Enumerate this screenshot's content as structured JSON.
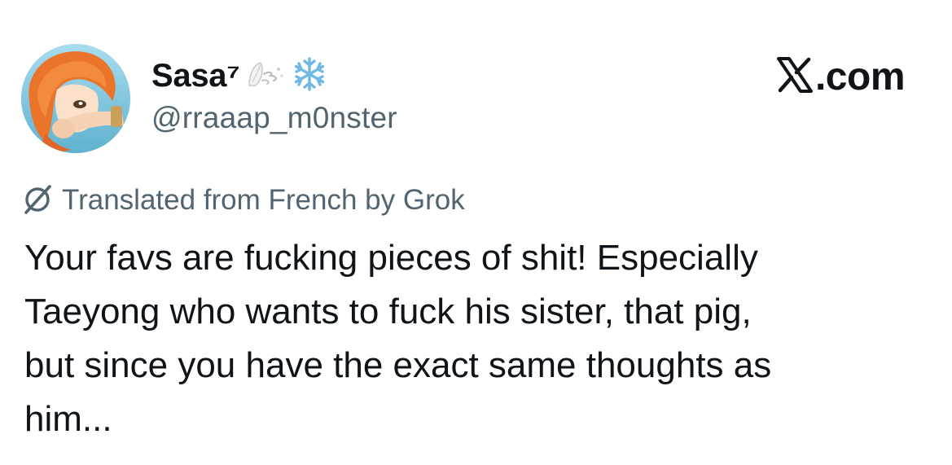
{
  "author": {
    "display_name": "Sasa⁷",
    "handle": "@rraaap_m0nster",
    "name_emojis": [
      "flower-petals-wind-emoji",
      "snowflake-emoji"
    ],
    "avatar": "anime-orange-hair-girl-avatar"
  },
  "brand": {
    "logo": "x-logo-icon",
    "domain": ".com"
  },
  "translation": {
    "icon": "grok-icon",
    "label": "Translated from French by Grok"
  },
  "tweet": {
    "lines": [
      "Your favs are fucking pieces of shit! Especially",
      "Taeyong who wants to fuck his sister, that pig,",
      "but since you have the exact same thoughts as",
      "him..."
    ]
  },
  "colors": {
    "text_primary": "#0f1419",
    "text_secondary": "#536471",
    "background": "#ffffff",
    "snowflake": "#6fb8e6"
  }
}
